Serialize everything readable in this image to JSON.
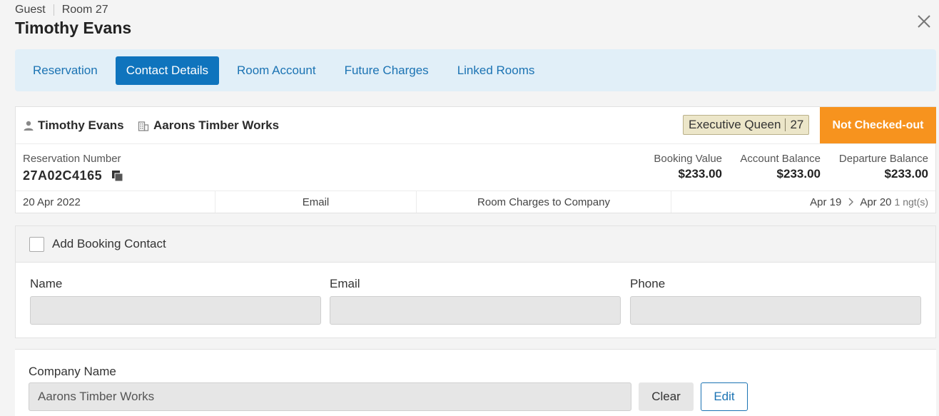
{
  "header": {
    "guest_label": "Guest",
    "room_label": "Room 27",
    "title": "Timothy Evans"
  },
  "tabs": [
    {
      "label": "Reservation",
      "active": false
    },
    {
      "label": "Contact Details",
      "active": true
    },
    {
      "label": "Room Account",
      "active": false
    },
    {
      "label": "Future Charges",
      "active": false
    },
    {
      "label": "Linked Rooms",
      "active": false
    }
  ],
  "summary": {
    "guest_name": "Timothy Evans",
    "company": "Aarons Timber Works",
    "room_type": "Executive Queen",
    "room_number": "27",
    "status": "Not Checked-out",
    "status_color": "#f7931e",
    "reservation_number_label": "Reservation Number",
    "reservation_number": "27A02C4165",
    "booking_value_label": "Booking Value",
    "booking_value": "$233.00",
    "account_balance_label": "Account Balance",
    "account_balance": "$233.00",
    "departure_balance_label": "Departure Balance",
    "departure_balance": "$233.00",
    "created_date": "20 Apr 2022",
    "source": "Email",
    "billing": "Room Charges to Company",
    "arrival": "Apr 19",
    "departure": "Apr 20",
    "nights": "1 ngt(s)"
  },
  "booking_contact": {
    "checkbox_label": "Add Booking Contact",
    "checked": false,
    "name_label": "Name",
    "name_value": "",
    "email_label": "Email",
    "email_value": "",
    "phone_label": "Phone",
    "phone_value": ""
  },
  "company": {
    "label": "Company Name",
    "value": "Aarons Timber Works",
    "clear_label": "Clear",
    "edit_label": "Edit"
  },
  "colors": {
    "accent": "#0f74bd",
    "tab_bg": "#e1eff8",
    "status": "#f7931e"
  }
}
